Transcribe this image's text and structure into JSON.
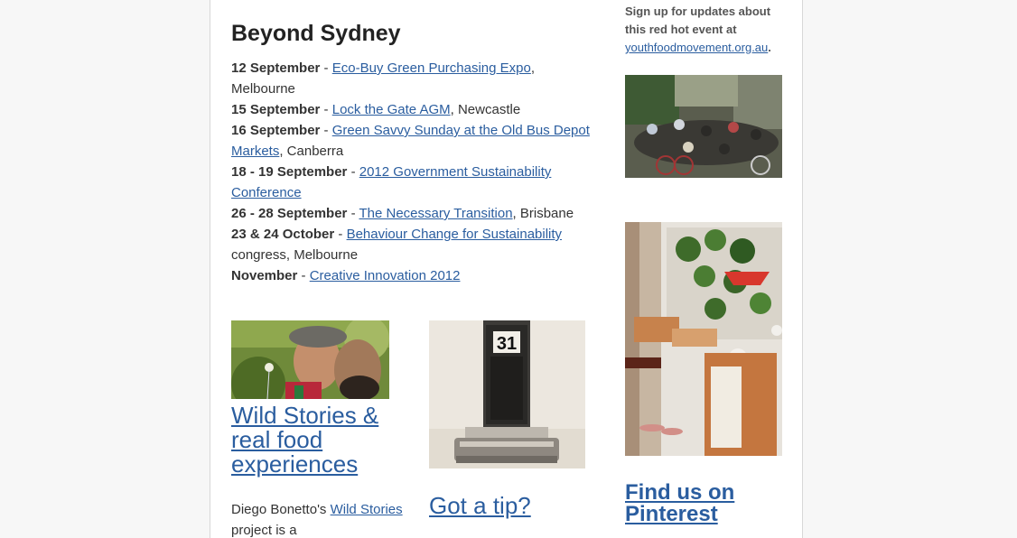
{
  "events_section": {
    "title": "Beyond Sydney",
    "items": [
      {
        "date": "12 September",
        "sep": " - ",
        "link": "Eco-Buy Green Purchasing Expo",
        "rest": ", Melbourne"
      },
      {
        "date": "15 September",
        "sep": " - ",
        "link": "Lock the Gate AGM",
        "rest": ", Newcastle"
      },
      {
        "date": "16 September",
        "sep": " - ",
        "link": "Green Savvy Sunday at the Old Bus Depot Markets",
        "rest": ", Canberra"
      },
      {
        "date": "18 - 19 September",
        "sep": " - ",
        "link": "2012 Government Sustainability Conference",
        "rest": ""
      },
      {
        "date": "26 - 28 September",
        "sep": " - ",
        "link": "The Necessary Transition",
        "rest": ", Brisbane"
      },
      {
        "date": "23 & 24 October",
        "sep": " - ",
        "link": "Behaviour Change for Sustainability",
        "rest": " congress, Melbourne"
      },
      {
        "date": "November",
        "sep": " - ",
        "link": "Creative Innovation 2012",
        "rest": ""
      }
    ]
  },
  "wild_stories": {
    "heading": "Wild Stories & real food experiences",
    "text_before": "Diego Bonetto's ",
    "text_link": "Wild Stories",
    "text_after": " project is a"
  },
  "tip": {
    "heading": "Got a tip?",
    "calendar_digit": "31"
  },
  "sidebar": {
    "signup_text": "Sign up for updates about this red hot event at ",
    "signup_link": "youthfoodmovement.org.au",
    "signup_end": ".",
    "pinterest_heading": "Find us on Pinterest"
  }
}
